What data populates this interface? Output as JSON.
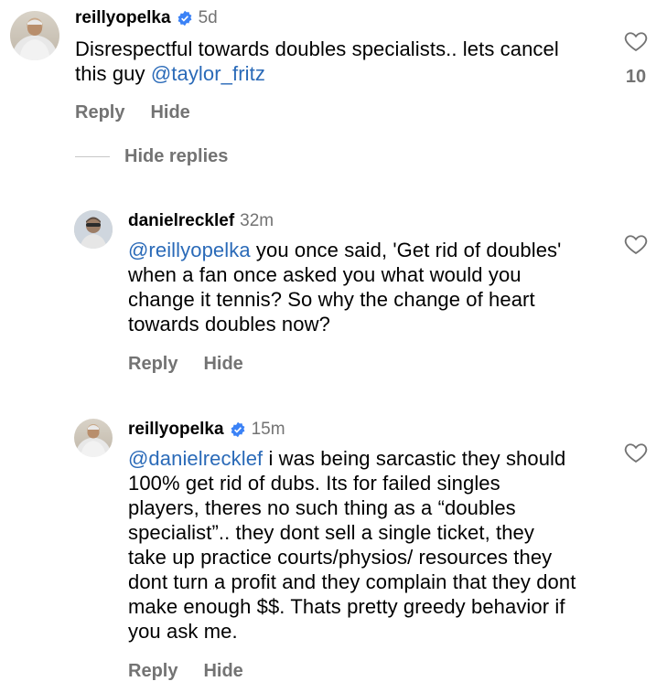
{
  "comments": [
    {
      "username": "reillyopelka",
      "verified": true,
      "time": "5d",
      "text_before": "Disrespectful towards doubles specialists.. lets cancel this guy ",
      "mention": "@taylor_fritz",
      "text_after": "",
      "like_count": "10",
      "reply_label": "Reply",
      "hide_label": "Hide"
    },
    {
      "username": "danielrecklef",
      "verified": false,
      "time": "32m",
      "mention": "@reillyopelka",
      "text_after": " you once said, 'Get rid of doubles' when a fan once asked you what would you change it tennis? So why the change of heart towards doubles now?",
      "reply_label": "Reply",
      "hide_label": "Hide"
    },
    {
      "username": "reillyopelka",
      "verified": true,
      "time": "15m",
      "mention": "@danielrecklef",
      "text_after": " i was being sarcastic they should 100% get rid of dubs. Its for failed singles players, theres no such thing as a “doubles specialist”.. they dont sell a single ticket, they take up practice courts/physios/ resources they dont turn a profit and they complain that they dont make enough $$. Thats pretty greedy behavior if you ask me.",
      "reply_label": "Reply",
      "hide_label": "Hide"
    }
  ],
  "hide_replies_label": "Hide replies",
  "colors": {
    "mention": "#2a6ab8",
    "muted": "#737373",
    "verified": "#3b82f6"
  }
}
